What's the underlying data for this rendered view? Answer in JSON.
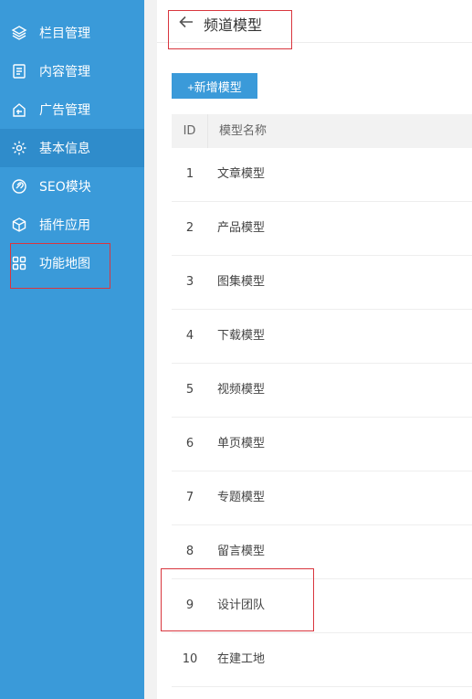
{
  "sidebar": {
    "items": [
      {
        "label": "栏目管理",
        "icon": "layers-icon"
      },
      {
        "label": "内容管理",
        "icon": "document-icon"
      },
      {
        "label": "广告管理",
        "icon": "ad-icon"
      },
      {
        "label": "基本信息",
        "icon": "gear-icon"
      },
      {
        "label": "SEO模块",
        "icon": "link-icon"
      },
      {
        "label": "插件应用",
        "icon": "cube-icon"
      },
      {
        "label": "功能地图",
        "icon": "grid-icon"
      }
    ]
  },
  "header": {
    "title": "频道模型"
  },
  "toolbar": {
    "add_label": "+新增模型"
  },
  "table": {
    "columns": [
      "ID",
      "模型名称"
    ],
    "rows": [
      {
        "id": "1",
        "name": "文章模型"
      },
      {
        "id": "2",
        "name": "产品模型"
      },
      {
        "id": "3",
        "name": "图集模型"
      },
      {
        "id": "4",
        "name": "下载模型"
      },
      {
        "id": "5",
        "name": "视频模型"
      },
      {
        "id": "6",
        "name": "单页模型"
      },
      {
        "id": "7",
        "name": "专题模型"
      },
      {
        "id": "8",
        "name": "留言模型"
      },
      {
        "id": "9",
        "name": "设计团队"
      },
      {
        "id": "10",
        "name": "在建工地"
      }
    ]
  },
  "colors": {
    "sidebar": "#3a9ad9",
    "sidebar_active": "#2f8ccb",
    "highlight_box": "#d9363e"
  }
}
